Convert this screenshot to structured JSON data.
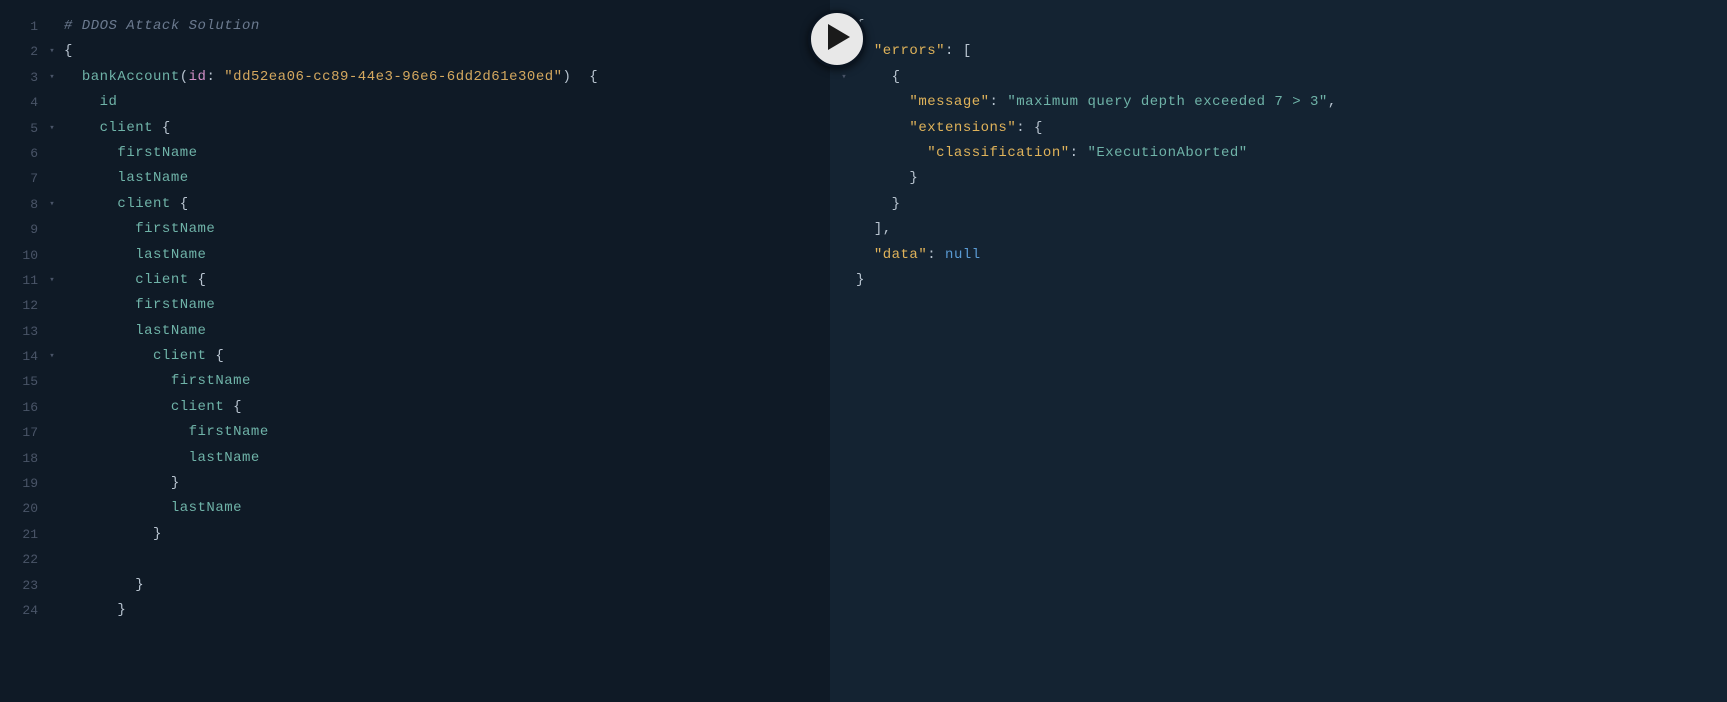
{
  "editor": {
    "left": {
      "lines": [
        {
          "n": "1",
          "fold": "",
          "tokens": [
            {
              "c": "tok-comment",
              "t": "# DDOS Attack Solution"
            }
          ]
        },
        {
          "n": "2",
          "fold": "▾",
          "tokens": [
            {
              "c": "tok-punct",
              "t": "{"
            }
          ]
        },
        {
          "n": "3",
          "fold": "▾",
          "tokens": [
            {
              "c": "",
              "t": "  "
            },
            {
              "c": "tok-field",
              "t": "bankAccount"
            },
            {
              "c": "tok-punct",
              "t": "("
            },
            {
              "c": "tok-attr",
              "t": "id"
            },
            {
              "c": "tok-punct",
              "t": ": "
            },
            {
              "c": "tok-string",
              "t": "\"dd52ea06-cc89-44e3-96e6-6dd2d61e30ed\""
            },
            {
              "c": "tok-punct",
              "t": ")  {"
            }
          ]
        },
        {
          "n": "4",
          "fold": "",
          "tokens": [
            {
              "c": "",
              "t": "    "
            },
            {
              "c": "tok-field",
              "t": "id"
            }
          ]
        },
        {
          "n": "5",
          "fold": "▾",
          "tokens": [
            {
              "c": "",
              "t": "    "
            },
            {
              "c": "tok-field",
              "t": "client"
            },
            {
              "c": "tok-punct",
              "t": " {"
            }
          ]
        },
        {
          "n": "6",
          "fold": "",
          "tokens": [
            {
              "c": "",
              "t": "      "
            },
            {
              "c": "tok-field",
              "t": "firstName"
            }
          ]
        },
        {
          "n": "7",
          "fold": "",
          "tokens": [
            {
              "c": "",
              "t": "      "
            },
            {
              "c": "tok-field",
              "t": "lastName"
            }
          ]
        },
        {
          "n": "8",
          "fold": "▾",
          "tokens": [
            {
              "c": "",
              "t": "      "
            },
            {
              "c": "tok-field",
              "t": "client"
            },
            {
              "c": "tok-punct",
              "t": " {"
            }
          ]
        },
        {
          "n": "9",
          "fold": "",
          "tokens": [
            {
              "c": "",
              "t": "        "
            },
            {
              "c": "tok-field",
              "t": "firstName"
            }
          ]
        },
        {
          "n": "10",
          "fold": "",
          "tokens": [
            {
              "c": "",
              "t": "        "
            },
            {
              "c": "tok-field",
              "t": "lastName"
            }
          ]
        },
        {
          "n": "11",
          "fold": "▾",
          "tokens": [
            {
              "c": "",
              "t": "        "
            },
            {
              "c": "tok-field",
              "t": "client"
            },
            {
              "c": "tok-punct",
              "t": " {"
            }
          ]
        },
        {
          "n": "12",
          "fold": "",
          "tokens": [
            {
              "c": "",
              "t": "        "
            },
            {
              "c": "tok-field",
              "t": "firstName"
            }
          ]
        },
        {
          "n": "13",
          "fold": "",
          "tokens": [
            {
              "c": "",
              "t": "        "
            },
            {
              "c": "tok-field",
              "t": "lastName"
            }
          ]
        },
        {
          "n": "14",
          "fold": "▾",
          "tokens": [
            {
              "c": "",
              "t": "          "
            },
            {
              "c": "tok-field",
              "t": "client"
            },
            {
              "c": "tok-punct",
              "t": " {"
            }
          ]
        },
        {
          "n": "15",
          "fold": "",
          "tokens": [
            {
              "c": "",
              "t": "            "
            },
            {
              "c": "tok-field",
              "t": "firstName"
            }
          ]
        },
        {
          "n": "16",
          "fold": "",
          "tokens": [
            {
              "c": "",
              "t": "            "
            },
            {
              "c": "tok-field",
              "t": "client"
            },
            {
              "c": "tok-punct",
              "t": " {"
            }
          ]
        },
        {
          "n": "17",
          "fold": "",
          "tokens": [
            {
              "c": "",
              "t": "              "
            },
            {
              "c": "tok-field",
              "t": "firstName"
            }
          ]
        },
        {
          "n": "18",
          "fold": "",
          "tokens": [
            {
              "c": "",
              "t": "              "
            },
            {
              "c": "tok-field",
              "t": "lastName"
            }
          ]
        },
        {
          "n": "19",
          "fold": "",
          "tokens": [
            {
              "c": "",
              "t": "            "
            },
            {
              "c": "tok-punct",
              "t": "}"
            }
          ]
        },
        {
          "n": "20",
          "fold": "",
          "tokens": [
            {
              "c": "",
              "t": "            "
            },
            {
              "c": "tok-field",
              "t": "lastName"
            }
          ]
        },
        {
          "n": "21",
          "fold": "",
          "tokens": [
            {
              "c": "",
              "t": "          "
            },
            {
              "c": "tok-punct",
              "t": "}"
            }
          ]
        },
        {
          "n": "22",
          "fold": "",
          "tokens": [
            {
              "c": "",
              "t": ""
            }
          ]
        },
        {
          "n": "23",
          "fold": "",
          "tokens": [
            {
              "c": "",
              "t": "        "
            },
            {
              "c": "tok-punct",
              "t": "}"
            }
          ]
        },
        {
          "n": "24",
          "fold": "",
          "tokens": [
            {
              "c": "",
              "t": "      "
            },
            {
              "c": "tok-punct",
              "t": "}"
            }
          ]
        }
      ]
    },
    "right": {
      "lines": [
        {
          "fold": "▾",
          "tokens": [
            {
              "c": "tok-punct",
              "t": "{"
            }
          ]
        },
        {
          "fold": "▾",
          "tokens": [
            {
              "c": "",
              "t": "  "
            },
            {
              "c": "tok-prop",
              "t": "\"errors\""
            },
            {
              "c": "tok-punct",
              "t": ": ["
            }
          ]
        },
        {
          "fold": "▾",
          "tokens": [
            {
              "c": "",
              "t": "    "
            },
            {
              "c": "tok-punct",
              "t": "{"
            }
          ]
        },
        {
          "fold": "",
          "tokens": [
            {
              "c": "",
              "t": "      "
            },
            {
              "c": "tok-prop",
              "t": "\"message\""
            },
            {
              "c": "tok-punct",
              "t": ": "
            },
            {
              "c": "tok-value",
              "t": "\"maximum query depth exceeded 7 > 3\""
            },
            {
              "c": "tok-punct",
              "t": ","
            }
          ]
        },
        {
          "fold": "",
          "tokens": [
            {
              "c": "",
              "t": "      "
            },
            {
              "c": "tok-prop",
              "t": "\"extensions\""
            },
            {
              "c": "tok-punct",
              "t": ": {"
            }
          ]
        },
        {
          "fold": "",
          "tokens": [
            {
              "c": "",
              "t": "        "
            },
            {
              "c": "tok-prop",
              "t": "\"classification\""
            },
            {
              "c": "tok-punct",
              "t": ": "
            },
            {
              "c": "tok-value",
              "t": "\"ExecutionAborted\""
            }
          ]
        },
        {
          "fold": "",
          "tokens": [
            {
              "c": "",
              "t": "      "
            },
            {
              "c": "tok-punct",
              "t": "}"
            }
          ]
        },
        {
          "fold": "",
          "tokens": [
            {
              "c": "",
              "t": "    "
            },
            {
              "c": "tok-punct",
              "t": "}"
            }
          ]
        },
        {
          "fold": "",
          "tokens": [
            {
              "c": "",
              "t": "  "
            },
            {
              "c": "tok-punct",
              "t": "],"
            }
          ]
        },
        {
          "fold": "",
          "tokens": [
            {
              "c": "",
              "t": "  "
            },
            {
              "c": "tok-prop",
              "t": "\"data\""
            },
            {
              "c": "tok-punct",
              "t": ": "
            },
            {
              "c": "tok-null",
              "t": "null"
            }
          ]
        },
        {
          "fold": "",
          "tokens": [
            {
              "c": "tok-punct",
              "t": "}"
            }
          ]
        }
      ]
    }
  }
}
